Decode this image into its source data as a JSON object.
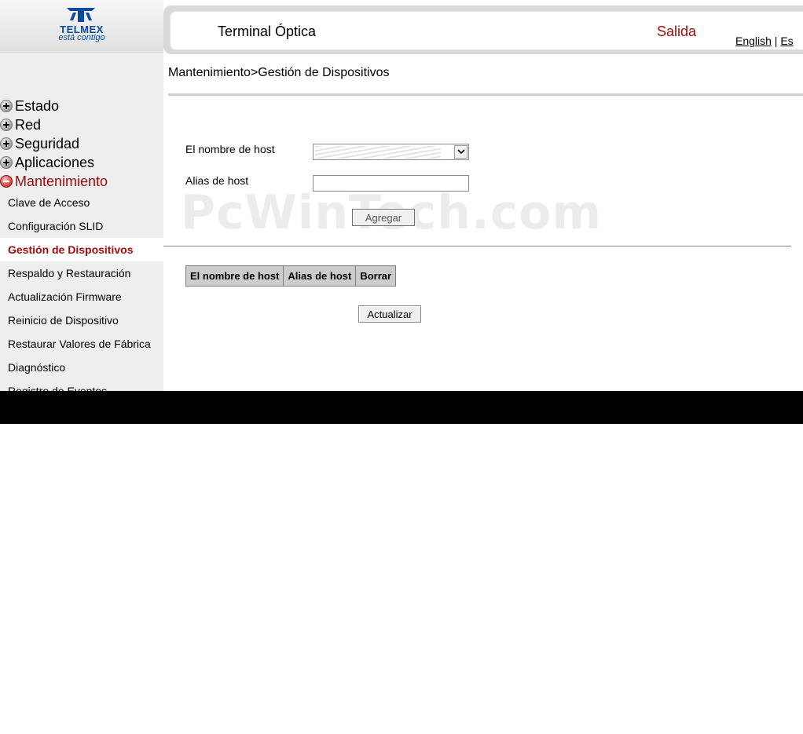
{
  "brand": {
    "name": "TELMEX",
    "tagline": "está contigo",
    "color": "#0a4aa0"
  },
  "header": {
    "title": "Terminal Óptica",
    "logout": "Salida",
    "lang_english": "English",
    "lang_separator": " | ",
    "lang_spanish": "Es"
  },
  "nav": {
    "top_items": [
      {
        "label": "Estado",
        "state": "collapsed"
      },
      {
        "label": "Red",
        "state": "collapsed"
      },
      {
        "label": "Seguridad",
        "state": "collapsed"
      },
      {
        "label": "Aplicaciones",
        "state": "collapsed"
      },
      {
        "label": "Mantenimiento",
        "state": "expanded"
      }
    ],
    "sub_items": [
      {
        "label": "Clave de Acceso"
      },
      {
        "label": "Configuración SLID"
      },
      {
        "label": "Gestión de Dispositivos",
        "selected": true
      },
      {
        "label": "Respaldo y Restauración"
      },
      {
        "label": "Actualización Firmware"
      },
      {
        "label": "Reinicio de Dispositivo"
      },
      {
        "label": "Restaurar Valores de Fábrica"
      },
      {
        "label": "Diagnóstico"
      },
      {
        "label": "Registro de Eventos"
      }
    ]
  },
  "breadcrumb": "Mantenimiento>Gestión de Dispositivos",
  "form": {
    "host_label": "El nombre de host",
    "host_value": "",
    "alias_label": "Alias de host",
    "alias_value": "",
    "add_button": "Agregar"
  },
  "table": {
    "headers": [
      "El nombre de host",
      "Alias de host",
      "Borrar"
    ],
    "rows": []
  },
  "refresh_button": "Actualizar",
  "watermark": "PcWinTech.com",
  "colors": {
    "accent_red": "#9c0a0a",
    "sidebar_bg": "#eeeeee",
    "table_header_bg": "#cccccc"
  }
}
